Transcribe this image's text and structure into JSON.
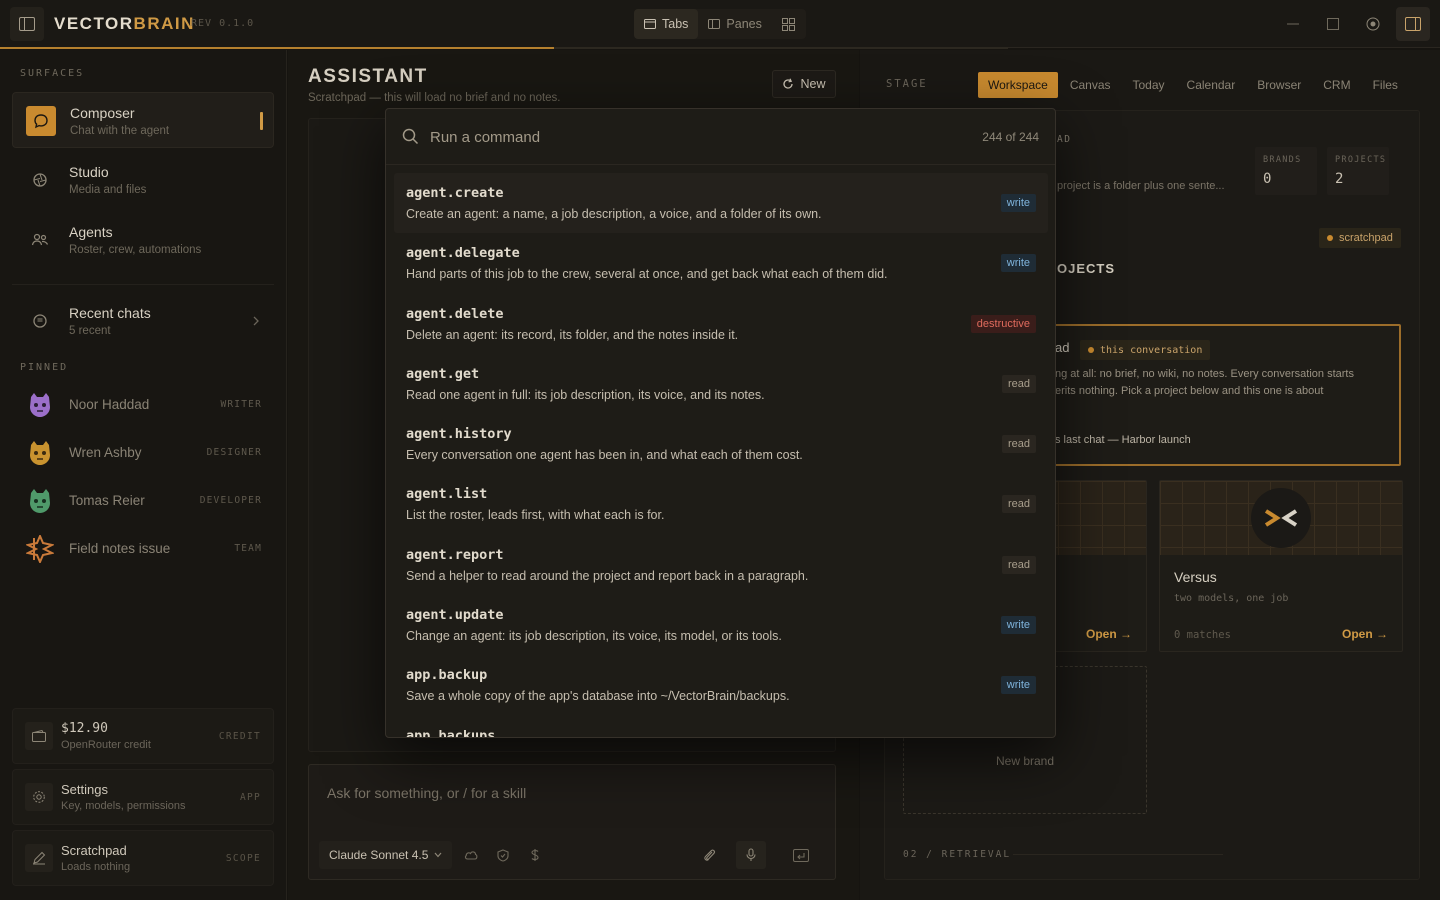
{
  "app": {
    "brand_part1": "VECTOR",
    "brand_part2": "BRAIN",
    "version": "REV 0.1.0",
    "progress": 0.55
  },
  "view_switch": {
    "tabs_label": "Tabs",
    "panes_label": "Panes",
    "active": "Tabs"
  },
  "sidebar": {
    "surfaces_label": "SURFACES",
    "items": [
      {
        "title": "Composer",
        "subtitle": "Chat with the agent",
        "icon": "chat-bubble-icon",
        "active": true
      },
      {
        "title": "Studio",
        "subtitle": "Media and files",
        "icon": "aperture-icon",
        "active": false
      },
      {
        "title": "Agents",
        "subtitle": "Roster, crew, automations",
        "icon": "users-icon",
        "active": false
      }
    ],
    "recent": {
      "title": "Recent chats",
      "subtitle": "5 recent"
    },
    "pinned_label": "PINNED",
    "pinned": [
      {
        "name": "Noor Haddad",
        "role": "WRITER",
        "color": "#9b6fc9"
      },
      {
        "name": "Wren Ashby",
        "role": "DESIGNER",
        "color": "#c9932f"
      },
      {
        "name": "Tomas Reier",
        "role": "DEVELOPER",
        "color": "#4f9a6a"
      },
      {
        "name": "Field notes issue",
        "role": "TEAM",
        "color": "#c97a3a"
      }
    ],
    "footer": [
      {
        "title": "$12.90",
        "subtitle": "OpenRouter credit",
        "tag": "CREDIT",
        "icon": "wallet-icon"
      },
      {
        "title": "Settings",
        "subtitle": "Key, models, permissions",
        "tag": "APP",
        "icon": "gear-icon"
      },
      {
        "title": "Scratchpad",
        "subtitle": "Loads nothing",
        "tag": "SCOPE",
        "icon": "pencil-icon"
      }
    ]
  },
  "assistant": {
    "title": "ASSISTANT",
    "subtitle": "Scratchpad — this will load no brief and no notes.",
    "new_label": "New",
    "composer_placeholder": "Ask for something, or / for a skill",
    "model": "Claude Sonnet 4.5"
  },
  "stage": {
    "label": "STAGE",
    "tabs": [
      "Workspace",
      "Canvas",
      "Today",
      "Calendar",
      "Browser",
      "CRM",
      "Files"
    ],
    "active_tab": "Workspace",
    "header_fragment": "AD",
    "desc_fragment": "project is a folder plus one sente...",
    "stats": [
      {
        "key": "BRANDS",
        "value": "0"
      },
      {
        "key": "PROJECTS",
        "value": "2"
      }
    ],
    "scratchpad_pill": "scratchpad",
    "projects_heading_fragment": "OJECTS",
    "conv_card": {
      "title_fragment": "ad",
      "pill": "this conversation",
      "line1": "ng at all: no brief, no wiki, no notes. Every conversation starts",
      "line2": "erits nothing. Pick a project below and this one is about",
      "last_chat": "s last chat — Harbor launch"
    },
    "card_left": {
      "open_label": "Open →"
    },
    "card_versus": {
      "title": "Versus",
      "subtitle": "two models, one job",
      "matches": "0 matches",
      "open_label": "Open →"
    },
    "new_brand": "New brand",
    "retrieval_label": "02 / RETRIEVAL"
  },
  "palette": {
    "placeholder": "Run a command",
    "count": "244 of 244",
    "commands": [
      {
        "name": "agent.create",
        "desc": "Create an agent: a name, a job description, a voice, and a folder of its own.",
        "badge": "write"
      },
      {
        "name": "agent.delegate",
        "desc": "Hand parts of this job to the crew, several at once, and get back what each of them did.",
        "badge": "write"
      },
      {
        "name": "agent.delete",
        "desc": "Delete an agent: its record, its folder, and the notes inside it.",
        "badge": "destructive"
      },
      {
        "name": "agent.get",
        "desc": "Read one agent in full: its job description, its voice, and its notes.",
        "badge": "read"
      },
      {
        "name": "agent.history",
        "desc": "Every conversation one agent has been in, and what each of them cost.",
        "badge": "read"
      },
      {
        "name": "agent.list",
        "desc": "List the roster, leads first, with what each is for.",
        "badge": "read"
      },
      {
        "name": "agent.report",
        "desc": "Send a helper to read around the project and report back in a paragraph.",
        "badge": "read"
      },
      {
        "name": "agent.update",
        "desc": "Change an agent: its job description, its voice, its model, or its tools.",
        "badge": "write"
      },
      {
        "name": "app.backup",
        "desc": "Save a whole copy of the app's database into ~/VectorBrain/backups.",
        "badge": "write"
      },
      {
        "name": "app.backups",
        "desc": "",
        "badge": ""
      }
    ]
  },
  "colors": {
    "accent": "#c98a2f",
    "bg": "#161410",
    "write": "#7fb4dc",
    "destructive": "#e06b5d"
  }
}
